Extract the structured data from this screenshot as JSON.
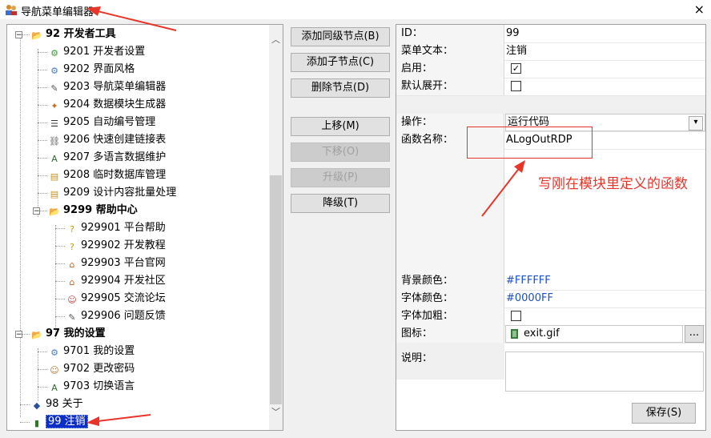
{
  "window": {
    "title": "导航菜单编辑器",
    "close_glyph": "×"
  },
  "tree": {
    "items": [
      {
        "id": "92",
        "label": "92 开发者工具",
        "level": 0,
        "bold": true,
        "icon": "folder-open-icon",
        "expander": "−"
      },
      {
        "id": "9201",
        "label": "9201 开发者设置",
        "level": 1,
        "icon": "gear-plug-icon"
      },
      {
        "id": "9202",
        "label": "9202 界面风格",
        "level": 1,
        "icon": "settings-gear-icon"
      },
      {
        "id": "9203",
        "label": "9203 导航菜单编辑器",
        "level": 1,
        "icon": "edit-document-icon"
      },
      {
        "id": "9204",
        "label": "9204 数据模块生成器",
        "level": 1,
        "icon": "magic-wand-icon"
      },
      {
        "id": "9205",
        "label": "9205 自动编号管理",
        "level": 1,
        "icon": "numbered-list-icon"
      },
      {
        "id": "9206",
        "label": "9206 快速创建链接表",
        "level": 1,
        "icon": "link-icon"
      },
      {
        "id": "9207",
        "label": "9207 多语言数据维护",
        "level": 1,
        "icon": "translate-icon"
      },
      {
        "id": "9208",
        "label": "9208 临时数据库管理",
        "level": 1,
        "icon": "database-icon"
      },
      {
        "id": "9209",
        "label": "9209 设计内容批量处理",
        "level": 1,
        "icon": "database-icon"
      },
      {
        "id": "9299",
        "label": "9299 帮助中心",
        "level": 1,
        "bold": true,
        "icon": "folder-open-icon",
        "expander": "−"
      },
      {
        "id": "929901",
        "label": "929901 平台帮助",
        "level": 2,
        "icon": "help-icon"
      },
      {
        "id": "929902",
        "label": "929902 开发教程",
        "level": 2,
        "icon": "help-icon"
      },
      {
        "id": "929903",
        "label": "929903 平台官网",
        "level": 2,
        "icon": "home-icon"
      },
      {
        "id": "929904",
        "label": "929904 开发社区",
        "level": 2,
        "icon": "home-icon"
      },
      {
        "id": "929905",
        "label": "929905 交流论坛",
        "level": 2,
        "icon": "users-icon"
      },
      {
        "id": "929906",
        "label": "929906 问题反馈",
        "level": 2,
        "icon": "edit-document-icon"
      },
      {
        "id": "97",
        "label": "97 我的设置",
        "level": 0,
        "bold": true,
        "icon": "folder-open-icon",
        "expander": "−"
      },
      {
        "id": "9701",
        "label": "9701 我的设置",
        "level": 1,
        "icon": "settings-gear-icon"
      },
      {
        "id": "9702",
        "label": "9702 更改密码",
        "level": 1,
        "icon": "user-key-icon"
      },
      {
        "id": "9703",
        "label": "9703 切换语言",
        "level": 1,
        "icon": "translate-icon"
      },
      {
        "id": "98",
        "label": "98 关于",
        "level": 0,
        "icon": "info-diamond-icon"
      },
      {
        "id": "99",
        "label": "99 注销",
        "level": 0,
        "icon": "exit-door-icon",
        "selected": true
      }
    ]
  },
  "buttons": {
    "add_sibling": "添加同级节点(B)",
    "add_child": "添加子节点(C)",
    "delete_node": "删除节点(D)",
    "move_up": "上移(M)",
    "move_down": "下移(O)",
    "promote": "升级(P)",
    "demote": "降级(T)"
  },
  "properties": {
    "id_label": "ID：",
    "id_value": "99",
    "menu_text_label": "菜单文本：",
    "menu_text_value": "注销",
    "enabled_label": "启用：",
    "enabled_value": "✓",
    "default_expand_label": "默认展开：",
    "default_expand_value": "",
    "operation_label": "操作：",
    "operation_value": "运行代码",
    "function_label": "函数名称：",
    "function_value": "ALogOutRDP",
    "bg_color_label": "背景颜色：",
    "bg_color_value": "#FFFFFF",
    "font_color_label": "字体颜色：",
    "font_color_value": "#0000FF",
    "bold_label": "字体加粗：",
    "bold_value": "",
    "icon_label": "图标：",
    "icon_value": "exit.gif",
    "icon_btn": "...",
    "desc_label": "说明：",
    "save_label": "保存(S)"
  },
  "annotation": {
    "text": "写刚在模块里定义的函数"
  },
  "colors": {
    "accent_red": "#e8352a",
    "selection_blue": "#0b2ec8",
    "link_blue": "#1a4fd0"
  }
}
